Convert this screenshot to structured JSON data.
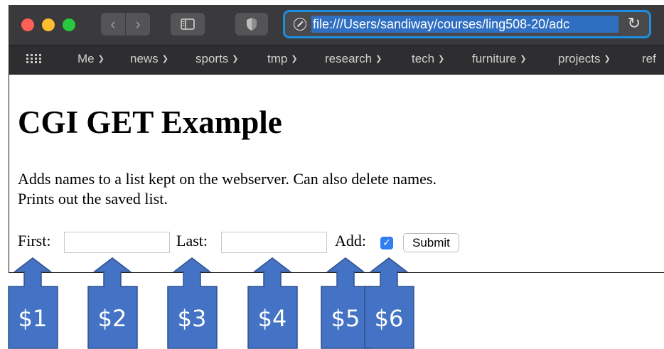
{
  "browser": {
    "url": "file:///Users/sandiway/courses/ling508-20/adc",
    "reload_icon": "reload-icon",
    "bookmarks": [
      {
        "label": "Me"
      },
      {
        "label": "news"
      },
      {
        "label": "sports"
      },
      {
        "label": "tmp"
      },
      {
        "label": "research"
      },
      {
        "label": "tech"
      },
      {
        "label": "furniture"
      },
      {
        "label": "projects"
      },
      {
        "label": "ref"
      }
    ]
  },
  "page": {
    "title": "CGI GET Example",
    "description_line1": "Adds names to a list kept on the webserver. Can also delete names.",
    "description_line2": "Prints out the saved list.",
    "form": {
      "first_label": "First:",
      "first_value": "",
      "last_label": "Last:",
      "last_value": "",
      "add_label": "Add:",
      "add_checked": true,
      "submit_label": "Submit"
    }
  },
  "annotations": [
    {
      "label": "$1"
    },
    {
      "label": "$2"
    },
    {
      "label": "$3"
    },
    {
      "label": "$4"
    },
    {
      "label": "$5"
    },
    {
      "label": "$6"
    }
  ],
  "colors": {
    "callout_fill": "#4472c4",
    "callout_stroke": "#2f528f",
    "address_focus": "#1d8fe0",
    "checkbox": "#2f7ff1"
  }
}
